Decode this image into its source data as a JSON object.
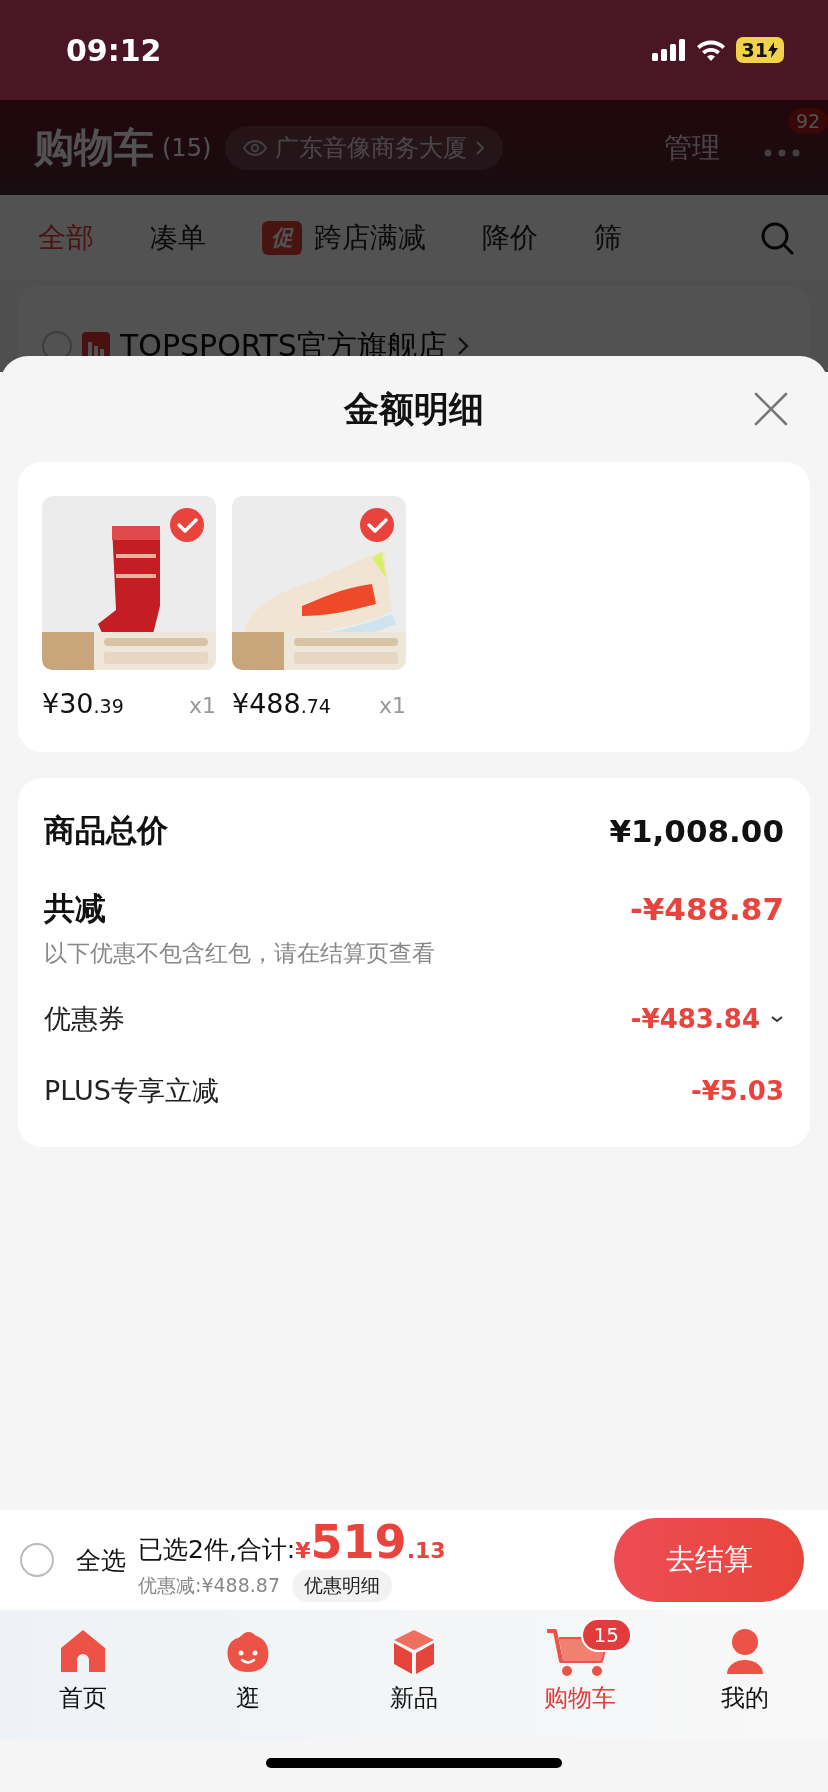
{
  "status_bar": {
    "time": "09:12",
    "battery": "31"
  },
  "header": {
    "title": "购物车",
    "count": "(15)",
    "location": "广东音像商务大厦",
    "manage": "管理",
    "more_badge": "92"
  },
  "filter_tabs": [
    {
      "label": "全部",
      "selected": true
    },
    {
      "label": "凑单",
      "selected": false
    },
    {
      "label": "跨店满减",
      "selected": false,
      "tag": "促"
    },
    {
      "label": "降价",
      "selected": false
    },
    {
      "label": "筛",
      "selected": false
    }
  ],
  "store": {
    "name": "TOPSPORTS官方旗舰店",
    "checked": false
  },
  "sheet": {
    "title": "金额明细",
    "products": [
      {
        "kind": "picture",
        "selected": true,
        "price": "¥30",
        "cents": ".39",
        "quantity": "x1"
      },
      {
        "kind": "picture",
        "selected": true,
        "price": "¥488",
        "cents": ".74",
        "quantity": "x1"
      }
    ],
    "rows": [
      {
        "kind": "total",
        "label": "商品总价",
        "value": "¥1,008.00"
      },
      {
        "kind": "reduction",
        "label": "共减",
        "value": "-¥488.87",
        "note": "以下优惠不包含红包，请在结算页查看"
      },
      {
        "kind": "item",
        "label": "优惠券",
        "value": "-¥483.84",
        "expandable": true
      },
      {
        "kind": "item",
        "label": "PLUS专享立减",
        "value": "-¥5.03"
      }
    ]
  },
  "checkout_bar": {
    "select_all": {
      "label": "全选",
      "checked": false
    },
    "selected_text": "已选2件,合计:",
    "currency": "¥",
    "amount": "519",
    "cents": ".13",
    "discount": "优惠减:¥488.87",
    "detail_button": "优惠明细",
    "checkout_button": "去结算"
  },
  "tab_bar": [
    {
      "kind": "home",
      "label": "首页",
      "selected": false
    },
    {
      "kind": "stroll",
      "label": "逛",
      "selected": false
    },
    {
      "kind": "new",
      "label": "新品",
      "selected": false
    },
    {
      "kind": "cart",
      "label": "购物车",
      "selected": true,
      "badge": "15"
    },
    {
      "kind": "profile",
      "label": "我的",
      "selected": false
    }
  ]
}
